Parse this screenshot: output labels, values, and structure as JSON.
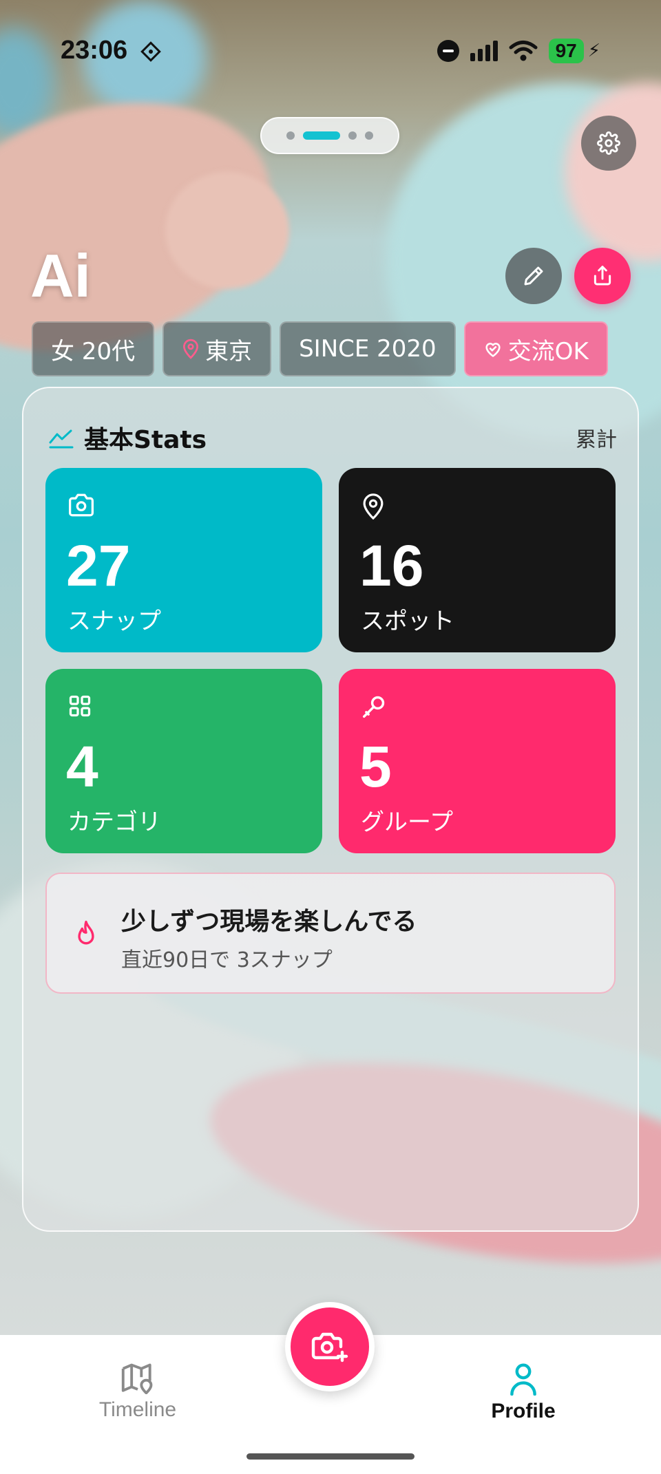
{
  "status_bar": {
    "time": "23:06",
    "battery": "97"
  },
  "profile": {
    "name": "Ai",
    "tags": [
      {
        "label": "女 20代"
      },
      {
        "label": "東京"
      },
      {
        "label": "SINCE 2020"
      },
      {
        "label": "交流OK"
      }
    ]
  },
  "stats": {
    "title": "基本Stats",
    "period": "累計",
    "tiles": [
      {
        "value": "27",
        "label": "スナップ",
        "color": "#00bac8",
        "icon": "camera-icon"
      },
      {
        "value": "16",
        "label": "スポット",
        "color": "#161616",
        "icon": "map-pin-icon"
      },
      {
        "value": "4",
        "label": "カテゴリ",
        "color": "#25b468",
        "icon": "grid-icon"
      },
      {
        "value": "5",
        "label": "グループ",
        "color": "#ff2a6d",
        "icon": "microphone-icon"
      }
    ],
    "streak": {
      "headline": "少しずつ現場を楽しんでる",
      "detail": "直近90日で 3スナップ"
    }
  },
  "nav": {
    "timeline": "Timeline",
    "profile": "Profile",
    "active": "profile"
  },
  "colors": {
    "accent": "#ff2a6d",
    "teal": "#00bac8"
  }
}
